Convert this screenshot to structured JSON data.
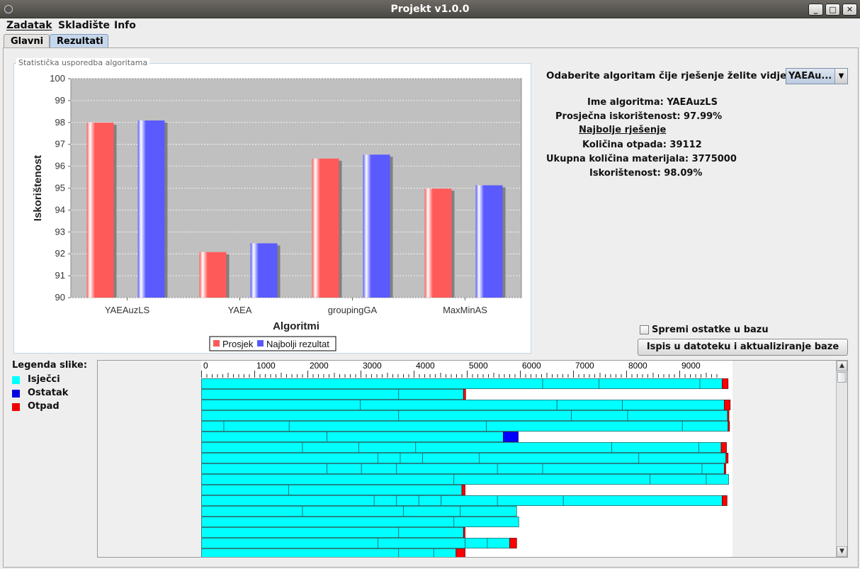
{
  "window": {
    "title": "Projekt v1.0.0"
  },
  "menu": [
    "Zadatak",
    "Skladište",
    "Info"
  ],
  "tabs": [
    "Glavni",
    "Rezultati"
  ],
  "chart_panel": {
    "caption": "Statistička usporedba algoritama"
  },
  "colors": {
    "prosjek": "#ff5a5a",
    "najbolji": "#5a5aff",
    "isjecci": "#00ffff",
    "ostatak": "#0000ff",
    "otpad": "#ff0000",
    "plot_bg": "#c0c0c0"
  },
  "chart_data": {
    "type": "bar",
    "categories": [
      "YAEAuzLS",
      "YAEA",
      "groupingGA",
      "MaxMinAS"
    ],
    "series": [
      {
        "name": "Prosjek",
        "values": [
          97.99,
          92.08,
          96.35,
          94.98
        ]
      },
      {
        "name": "Najbolji rezultat",
        "values": [
          98.09,
          92.48,
          96.53,
          95.13
        ]
      }
    ],
    "xlabel": "Algoritmi",
    "ylabel": "Iskorištenost",
    "ylim": [
      90,
      100
    ],
    "yticks": [
      90,
      91,
      92,
      93,
      94,
      95,
      96,
      97,
      98,
      99,
      100
    ],
    "grid": true,
    "legend": "bottom"
  },
  "results": {
    "select_prompt": "Odaberite algoritam čije rješenje želite vidjeti:",
    "selected_algorithm": "YAEAu...",
    "algo_name": "Ime algoritma: YAEAuzLS",
    "avg_util": "Prosječna iskorištenost: 97.99%",
    "best_heading": "Najbolje rješenje",
    "waste": "Količina otpada: 39112",
    "material": "Ukupna količina materijala: 3775000",
    "util": "Iskorištenost: 98.09%"
  },
  "save_checkbox": {
    "label": "Spremi ostatke u bazu",
    "checked": false
  },
  "export_button": "Ispis u datoteku i aktualiziranje baze",
  "image_legend": {
    "title": "Legenda slike:",
    "items": [
      "Isječci",
      "Ostatak",
      "Otpad"
    ]
  },
  "ruler": {
    "labels": [
      "0",
      "1000",
      "2000",
      "3000",
      "4000",
      "5000",
      "6000",
      "7000",
      "8000",
      "9000"
    ],
    "max": 10000
  },
  "cutting_rows": [
    {
      "cuts": [
        6420,
        1060,
        1900,
        420
      ],
      "remnant": 0,
      "waste": 110
    },
    {
      "cuts": [
        3710,
        1220
      ],
      "remnant": 0,
      "waste": 40
    },
    {
      "cuts": [
        2990,
        3700,
        1230,
        1920
      ],
      "remnant": 0,
      "waste": 110
    },
    {
      "cuts": [
        3710,
        3250,
        1060,
        1880
      ],
      "remnant": 0,
      "waste": 20
    },
    {
      "cuts": [
        420,
        1230,
        3710,
        3690,
        860
      ],
      "remnant": 0,
      "waste": 20
    },
    {
      "cuts": [
        2360,
        3320
      ],
      "remnant": 280,
      "waste": 0
    },
    {
      "cuts": [
        1900,
        1060,
        1070,
        3690,
        1640,
        420
      ],
      "remnant": 0,
      "waste": 100
    },
    {
      "cuts": [
        3320,
        420,
        420,
        1070,
        3000,
        1640
      ],
      "remnant": 0,
      "waste": 40
    },
    {
      "cuts": [
        2360,
        650,
        660,
        1900,
        850,
        3000,
        420
      ],
      "remnant": 0,
      "waste": 20
    },
    {
      "cuts": [
        4750,
        3690,
        1060,
        420
      ],
      "remnant": 0,
      "waste": 0
    },
    {
      "cuts": [
        1640,
        3260
      ],
      "remnant": 0,
      "waste": 60
    },
    {
      "cuts": [
        3250,
        420,
        420,
        420,
        1060,
        1240,
        2990
      ],
      "remnant": 0,
      "waste": 90
    },
    {
      "cuts": [
        1900,
        1900,
        1070,
        1060
      ],
      "remnant": 0,
      "waste": 0
    },
    {
      "cuts": [
        4750,
        1220
      ],
      "remnant": 0,
      "waste": 0
    },
    {
      "cuts": [
        3710,
        1220
      ],
      "remnant": 0,
      "waste": 30
    },
    {
      "cuts": [
        3320,
        1640,
        420,
        420
      ],
      "remnant": 0,
      "waste": 130
    },
    {
      "cuts": [
        3710,
        660,
        420
      ],
      "remnant": 0,
      "waste": 170
    }
  ]
}
